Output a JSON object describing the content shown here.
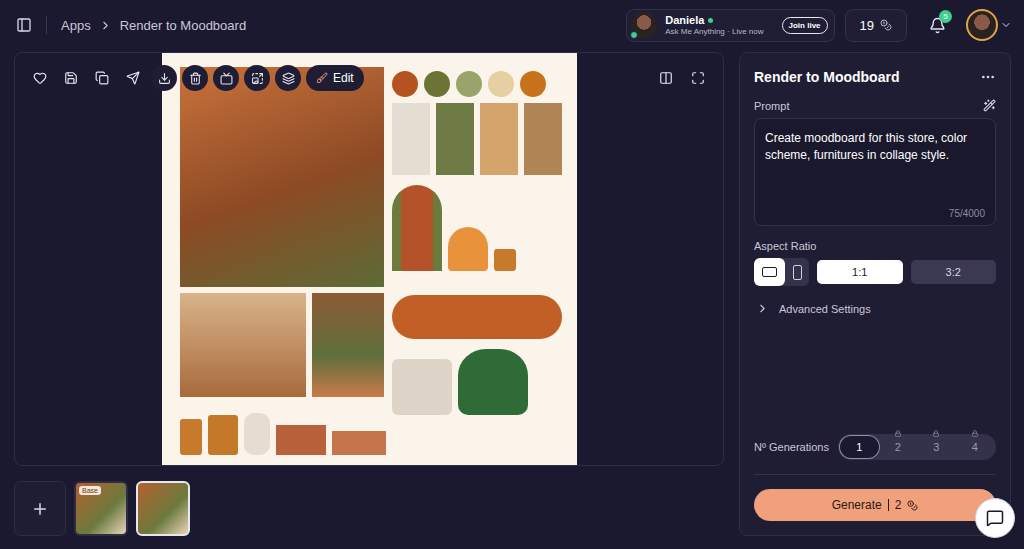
{
  "topbar": {
    "breadcrumb": [
      {
        "label": "Apps"
      },
      {
        "label": "Render to Moodboard"
      }
    ],
    "live": {
      "name": "Daniela",
      "online": true,
      "subtitle": "Ask Me Anything · Live now",
      "button": "Join live"
    },
    "credits": "19",
    "notifications": "5"
  },
  "canvas": {
    "edit_button": "Edit"
  },
  "thumbnails": [
    {
      "badge": "Base",
      "selected": false
    },
    {
      "badge": null,
      "selected": true
    }
  ],
  "panel": {
    "title": "Render to Moodboard",
    "prompt": {
      "label": "Prompt",
      "text": "Create moodboard for this store, color scheme, furnitures in collage style.",
      "counter": "75/4000"
    },
    "aspect_ratio": {
      "label": "Aspect Ratio",
      "orientations": [
        {
          "kind": "landscape",
          "selected": true
        },
        {
          "kind": "portrait",
          "selected": false
        }
      ],
      "ratios": [
        {
          "label": "1:1",
          "selected": true
        },
        {
          "label": "3:2",
          "selected": false
        }
      ]
    },
    "advanced": {
      "label": "Advanced Settings",
      "expanded": false
    },
    "generations": {
      "label": "Nº Generations",
      "options": [
        {
          "label": "1",
          "selected": true,
          "locked": false
        },
        {
          "label": "2",
          "selected": false,
          "locked": true
        },
        {
          "label": "3",
          "selected": false,
          "locked": true
        },
        {
          "label": "4",
          "selected": false,
          "locked": true
        }
      ]
    },
    "generate": {
      "label": "Generate",
      "cost": "2"
    }
  }
}
